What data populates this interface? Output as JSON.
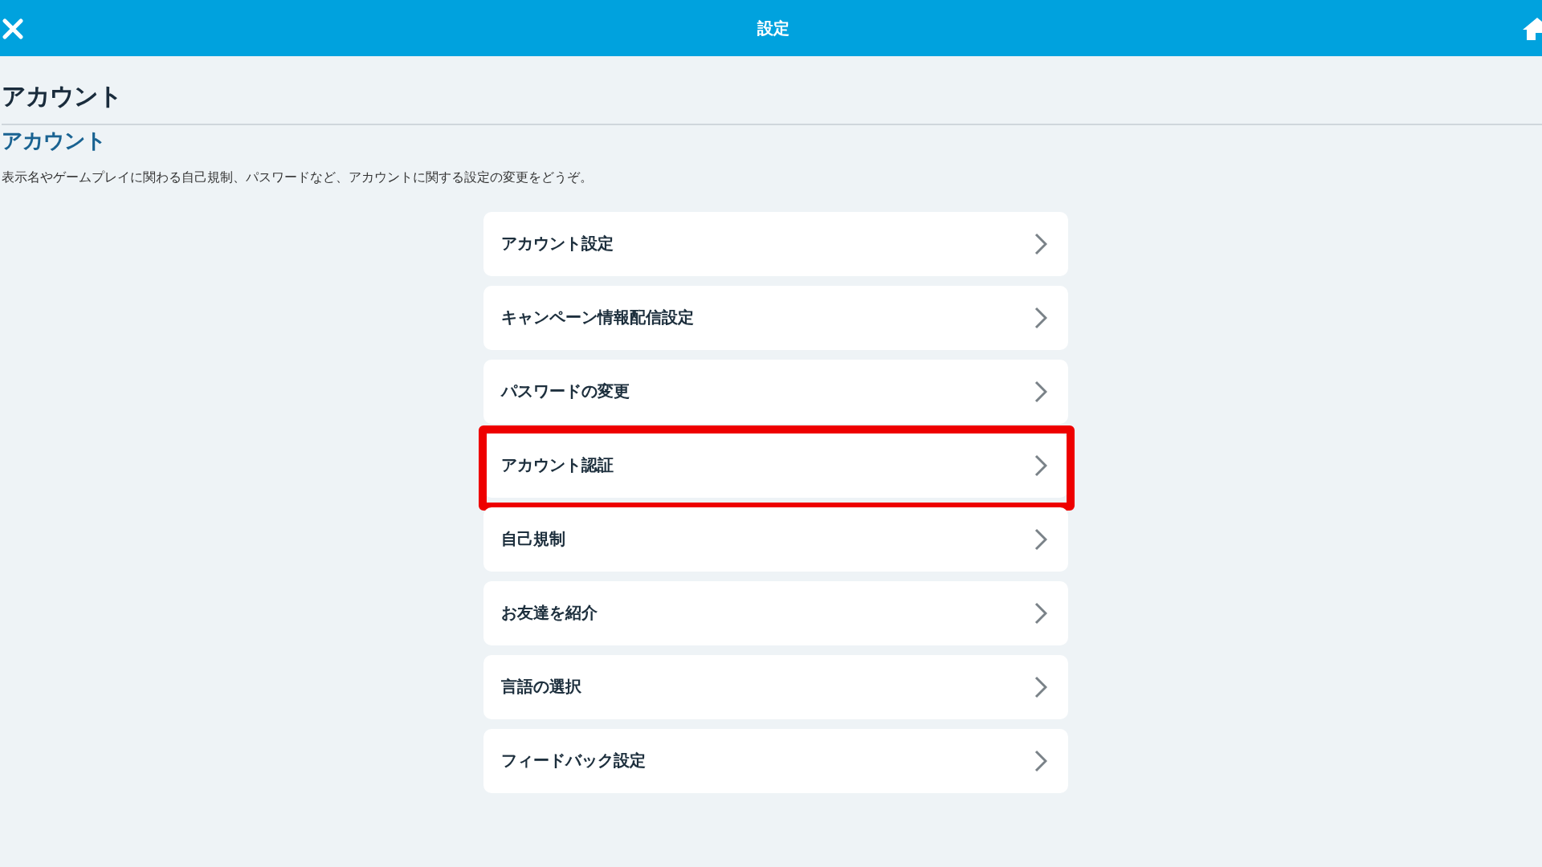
{
  "header": {
    "title": "設定"
  },
  "page_title": "アカウント",
  "section": {
    "title": "アカウント",
    "description": "表示名やゲームプレイに関わる自己規制、パスワードなど、アカウントに関する設定の変更をどうぞ。"
  },
  "items": [
    {
      "label": "アカウント設定",
      "highlighted": false
    },
    {
      "label": "キャンペーン情報配信設定",
      "highlighted": false
    },
    {
      "label": "パスワードの変更",
      "highlighted": false
    },
    {
      "label": "アカウント認証",
      "highlighted": true
    },
    {
      "label": "自己規制",
      "highlighted": false
    },
    {
      "label": "お友達を紹介",
      "highlighted": false
    },
    {
      "label": "言語の選択",
      "highlighted": false
    },
    {
      "label": "フィードバック設定",
      "highlighted": false
    }
  ]
}
